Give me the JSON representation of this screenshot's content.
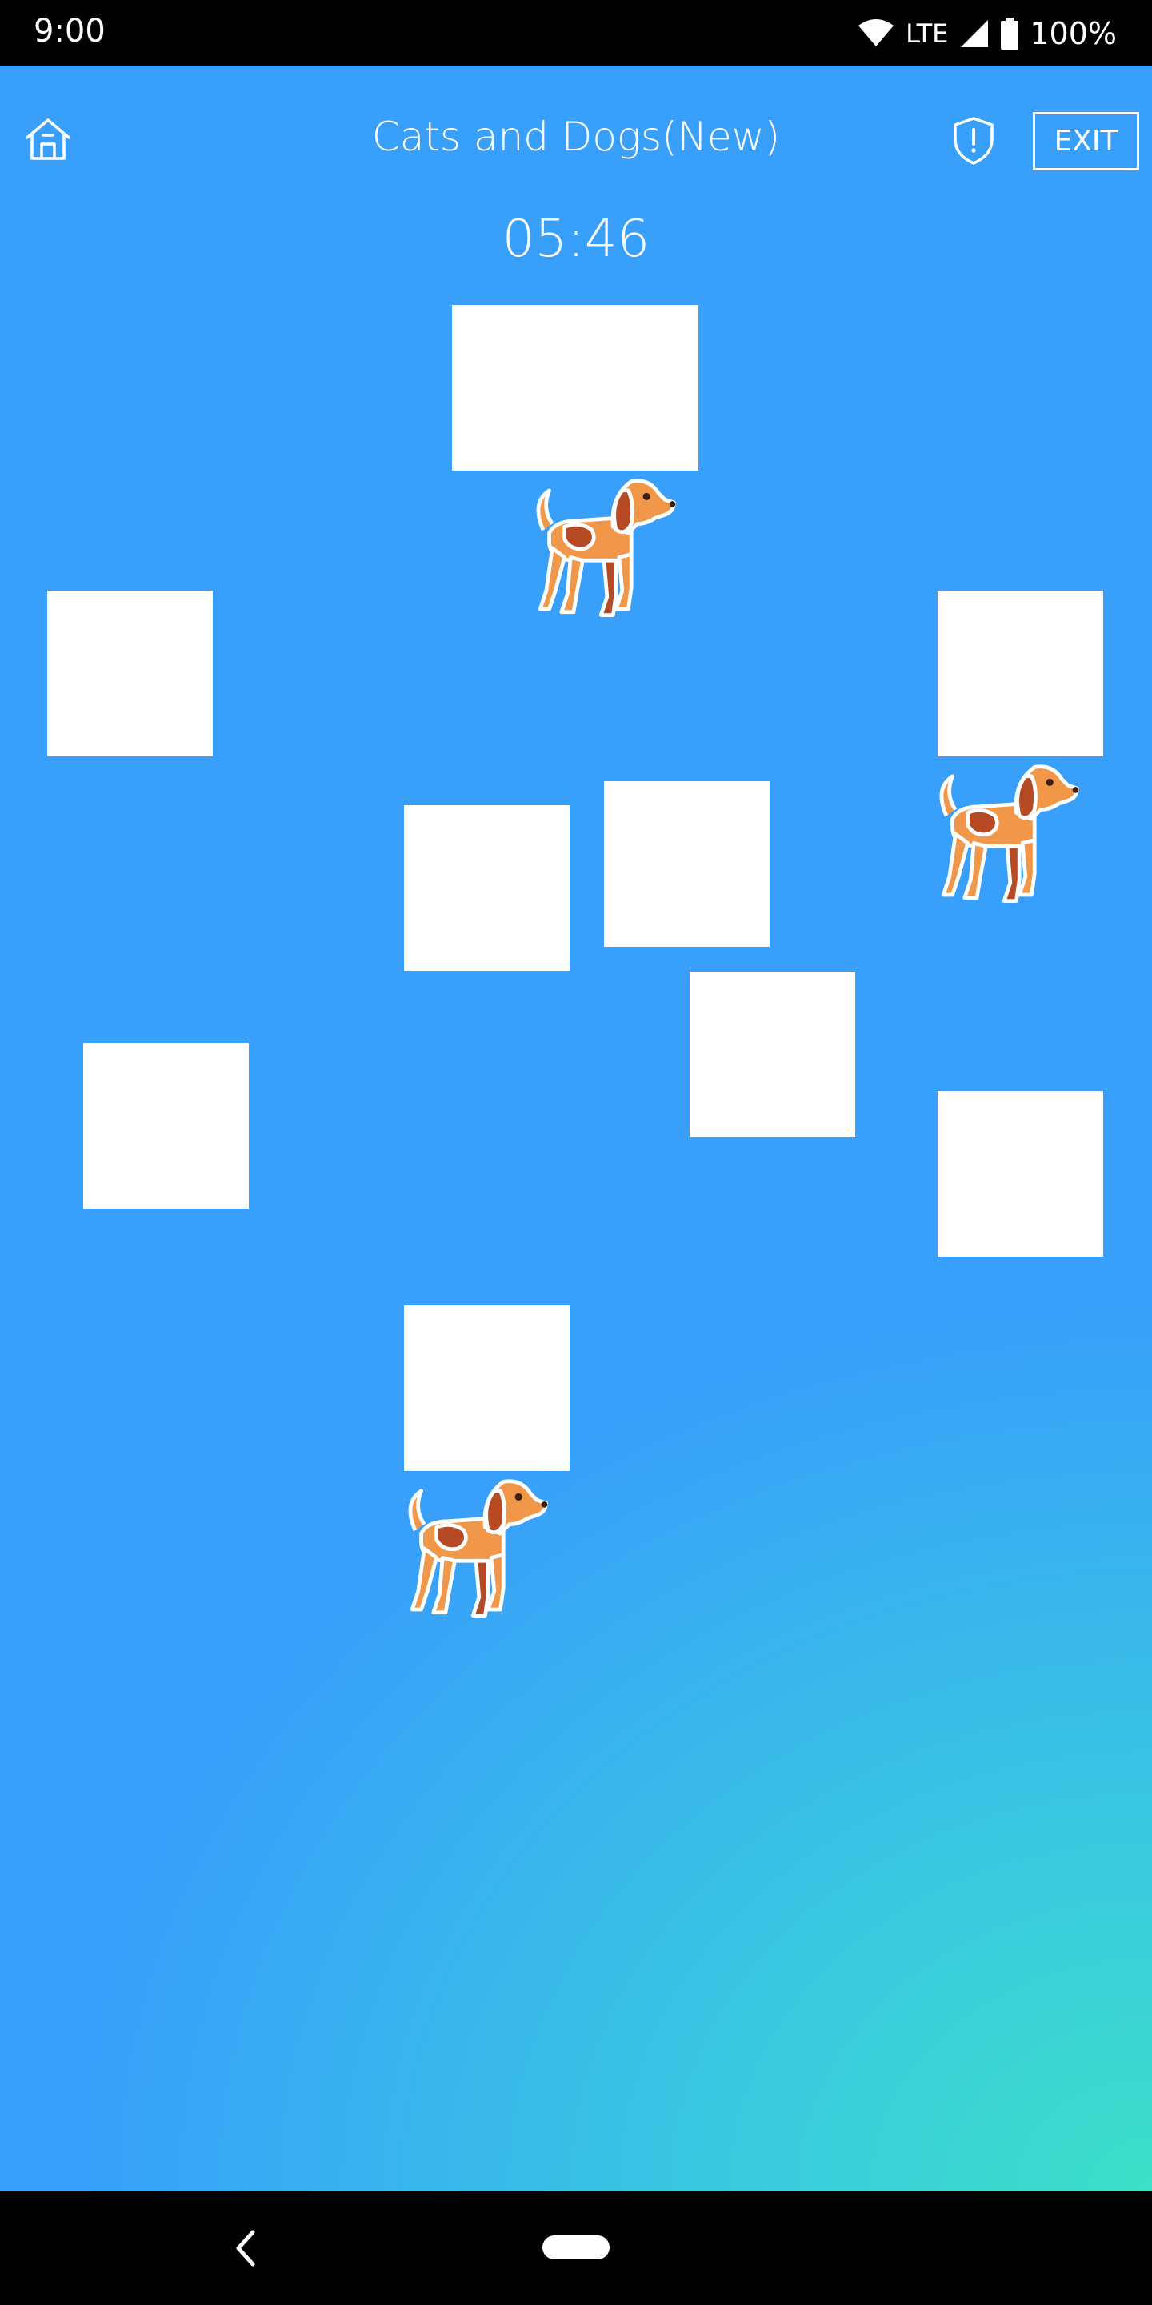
{
  "status_bar": {
    "time": "9:00",
    "network": "LTE",
    "battery": "100%"
  },
  "header": {
    "title": "Cats and Dogs(New)",
    "exit_label": "EXIT",
    "home_icon": "home-icon",
    "shield_icon": "shield-alert-icon"
  },
  "game": {
    "timer": "05:46",
    "cards": [
      {
        "state": "face-down"
      },
      {
        "state": "face-down"
      },
      {
        "state": "face-down"
      },
      {
        "state": "face-down"
      },
      {
        "state": "face-down"
      },
      {
        "state": "face-down"
      },
      {
        "state": "face-down"
      },
      {
        "state": "face-down"
      },
      {
        "state": "face-down"
      }
    ],
    "animals": [
      "dog",
      "dog",
      "dog"
    ]
  },
  "colors": {
    "background_top": "#389ffb",
    "background_bottom": "#3de0c8",
    "card": "#ffffff",
    "dog_body": "#f0974a",
    "dog_spot": "#b54a25"
  },
  "nav_bar": {
    "back_icon": "back-chevron-icon",
    "home_icon": "home-pill-icon"
  }
}
